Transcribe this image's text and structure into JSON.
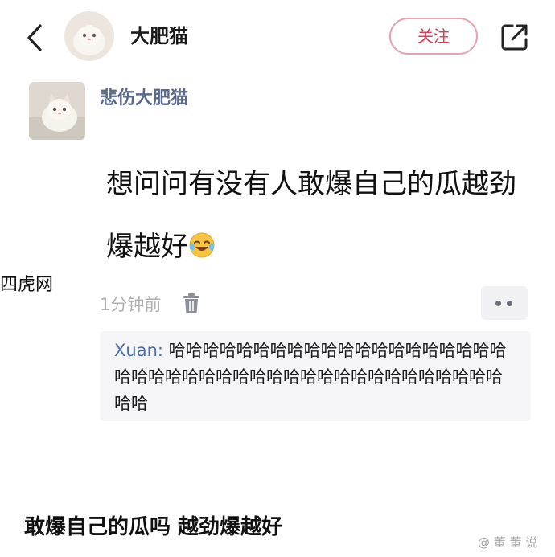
{
  "header": {
    "back_icon": "back-arrow-icon",
    "user_name": "大肥猫",
    "follow_label": "关注",
    "share_icon": "share-icon",
    "accent_color": "#e23c5a"
  },
  "post": {
    "author": "悲伤大肥猫",
    "text": "想问问有没有人敢爆自己的瓜越劲爆越好",
    "emoji": "laughing-tears-emoji",
    "time": "1分钟前",
    "delete_icon": "trash-icon",
    "more_icon": "more-dots-icon"
  },
  "comment": {
    "user": "Xuan:",
    "text": " 哈哈哈哈哈哈哈哈哈哈哈哈哈哈哈哈哈哈哈哈哈哈哈哈哈哈哈哈哈哈哈哈哈哈哈哈哈哈哈哈哈哈哈哈哈"
  },
  "caption": "敢爆自己的瓜吗 越劲爆越好",
  "watermarks": {
    "left": "四虎网",
    "right": "@ 董 董 说"
  }
}
